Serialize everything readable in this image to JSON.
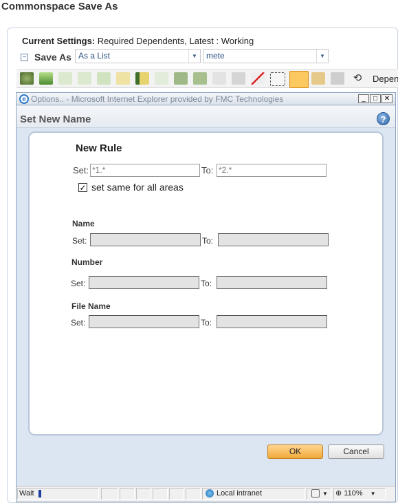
{
  "app": {
    "title": "Commonspace Save As",
    "current_settings_label": "Current Settings:",
    "current_settings_value": "Required Dependents, Latest : Working",
    "save_as_label": "Save As",
    "list_mode_select": "As a List",
    "context_select": "mete",
    "toolbar_trailing_label": "Depen"
  },
  "dialog": {
    "window_title": "Options.. - Microsoft Internet Explorer provided by FMC Technologies",
    "header": "Set New Name",
    "new_rule": {
      "heading": "New Rule",
      "set_label": "Set:",
      "set_value": "*1.*",
      "to_label": "To:",
      "to_value": "*2.*",
      "same_for_all_label": "set same for all areas",
      "same_for_all_checked": true
    },
    "sections": [
      {
        "heading": "Name",
        "set_label": "Set:",
        "to_label": "To:"
      },
      {
        "heading": "Number",
        "set_label": "Set:",
        "to_label": "To:"
      },
      {
        "heading": "File Name",
        "set_label": "Set:",
        "to_label": "To:"
      }
    ],
    "ok_label": "OK",
    "cancel_label": "Cancel"
  },
  "statusbar": {
    "status_text": "Wait",
    "zone": "Local intranet",
    "zoom": "110%"
  },
  "colors": {
    "accent_orange": "#f0a93a",
    "dialog_bg": "#dce6f2",
    "disabled_field": "#e3e3e3"
  }
}
